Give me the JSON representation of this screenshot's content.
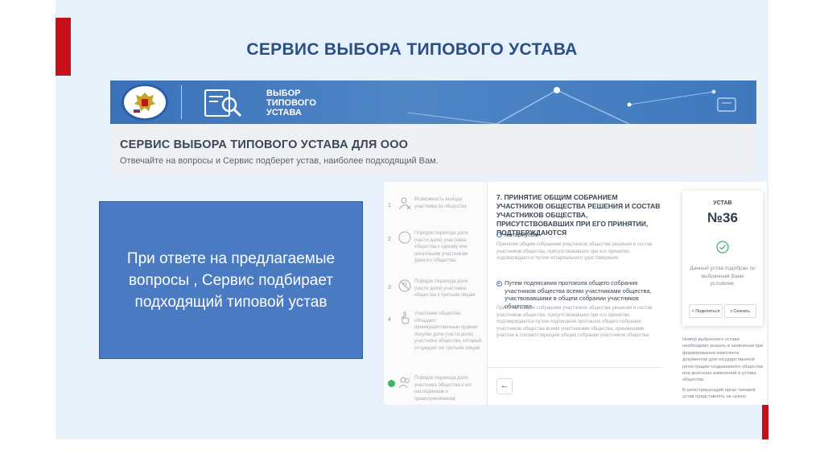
{
  "slide": {
    "title": "СЕРВИС ВЫБОРА ТИПОВОГО УСТАВА",
    "accent_color": "#c8101a",
    "box_text": "При ответе на предлагаемые вопросы , Сервис подбирает подходящий  типовой устав"
  },
  "site": {
    "banner_emblem_text": "НАЛОГОВАЯ СЛУЖБА",
    "banner_name": "ВЫБОР\nТИПОВОГО\nУСТАВА",
    "heading": "СЕРВИС ВЫБОРА ТИПОВОГО УСТАВА ДЛЯ ООО",
    "subheading": "Отвечайте на вопросы и Сервис подберет устав, наиболее подходящий Вам."
  },
  "steps": [
    {
      "num": "1",
      "icon": "person-x-icon",
      "text": "Возможность выхода участника из общества"
    },
    {
      "num": "2",
      "icon": "circle-icon",
      "text": "Порядок перехода доли (части доли) участника общества к одному или нескольким участникам данного общества"
    },
    {
      "num": "3",
      "icon": "person-no-icon",
      "text": "Порядок перехода доли (части доли) участника общества к третьим лицам"
    },
    {
      "num": "4",
      "icon": "hand-icon",
      "text": "Участники общества обладают преимущественным правом покупки доли (части доли) участника общества, который отчуждает ее третьим лицам"
    },
    {
      "num": "",
      "icon": "people-icon",
      "text": "Порядок перехода доли участника общества к его наследникам и правопреемникам"
    }
  ],
  "question": {
    "title": "7. ПРИНЯТИЕ ОБЩИМ СОБРАНИЕМ УЧАСТНИКОВ ОБЩЕСТВА РЕШЕНИЯ И СОСТАВ УЧАСТНИКОВ ОБЩЕСТВА, ПРИСУТСТВОВАВШИХ ПРИ ЕГО ПРИНЯТИИ, ПОДТВЕРЖДАЮТСЯ",
    "options": [
      {
        "label": "Нотариусом",
        "selected": false,
        "desc": "Принятие общим собранием участников общества решения и состав участников общества, присутствовавших при его принятии, подтверждаются путем нотариального удостоверения."
      },
      {
        "label": "Путем подписания протокола общего собрания участников общества всеми участниками общества, участвовавшими в общем собрании участников общества",
        "selected": true,
        "desc": "Принятие общим собранием участников общества решения и состав участников общества, присутствовавших при его принятии, подтверждаются путем подписания протокола общего собрания участников общества всеми участниками общества, принявшими участие в соответствующем общем собрании участников общества."
      }
    ],
    "back_icon": "←"
  },
  "result": {
    "label": "УСТАВ",
    "number": "№36",
    "text": "Данный устав подобран по выбранным Вами условиям.",
    "share_label": "Поделиться",
    "download_label": "Скачать",
    "success_color": "#3fb36b"
  },
  "side_note": {
    "p1": "Номер выбранного устава необходимо указать в заявлении при формировании комплекта документов для государственной регистрации создаваемого общества или внесения изменений в устава общества.",
    "p2": "В регистрирующий орган типовой устав представлять не нужно."
  }
}
